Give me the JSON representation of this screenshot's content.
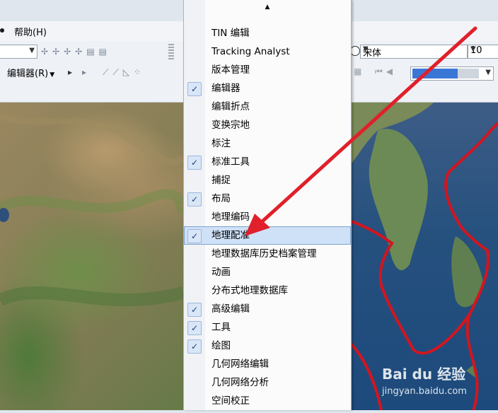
{
  "menubar": {
    "help_label": "帮助(H)"
  },
  "toolbar": {
    "editor_label": "编辑器(R)",
    "font_name": "宋体",
    "font_size": "10"
  },
  "menu": {
    "scroll_indicator": "▲",
    "items": [
      {
        "label": "TIN 编辑",
        "checked": false
      },
      {
        "label": "Tracking Analyst",
        "checked": false
      },
      {
        "label": "版本管理",
        "checked": false
      },
      {
        "label": "编辑器",
        "checked": true
      },
      {
        "label": "编辑折点",
        "checked": false
      },
      {
        "label": "变换宗地",
        "checked": false
      },
      {
        "label": "标注",
        "checked": false
      },
      {
        "label": "标准工具",
        "checked": true
      },
      {
        "label": "捕捉",
        "checked": false
      },
      {
        "label": "布局",
        "checked": true
      },
      {
        "label": "地理编码",
        "checked": false
      },
      {
        "label": "地理配准",
        "checked": true,
        "highlighted": true
      },
      {
        "label": "地理数据库历史档案管理",
        "checked": false
      },
      {
        "label": "动画",
        "checked": false
      },
      {
        "label": "分布式地理数据库",
        "checked": false
      },
      {
        "label": "高级编辑",
        "checked": true
      },
      {
        "label": "工具",
        "checked": true
      },
      {
        "label": "绘图",
        "checked": true
      },
      {
        "label": "几何网络编辑",
        "checked": false
      },
      {
        "label": "几何网络分析",
        "checked": false
      },
      {
        "label": "空间校正",
        "checked": false
      }
    ]
  },
  "watermark": {
    "logo": "Bai du 经验",
    "url": "jingyan.baidu.com"
  },
  "colors": {
    "arrow": "#e0202a",
    "boundary": "#d3151f",
    "highlight": "#cfe1f7"
  }
}
